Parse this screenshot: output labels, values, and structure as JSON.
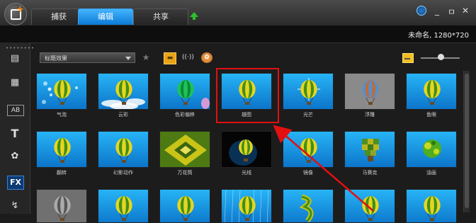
{
  "app": {
    "tabs": [
      {
        "label": "捕获",
        "active": false
      },
      {
        "label": "编辑",
        "active": true
      },
      {
        "label": "共享",
        "active": false
      }
    ],
    "window_controls": {
      "minimize": "_",
      "restore": "ㅁ",
      "close": "✕"
    },
    "project_info": "未命名, 1280*720"
  },
  "toolbar": {
    "category_select": "标题效果",
    "favorite_icon": "star-add-icon"
  },
  "sidebar": {
    "items": [
      {
        "name": "media-library-icon",
        "glyph": "▤"
      },
      {
        "name": "instant-project-icon",
        "glyph": "▦"
      },
      {
        "name": "transition-icon",
        "glyph": "AB"
      },
      {
        "name": "title-icon",
        "glyph": "T"
      },
      {
        "name": "graphic-icon",
        "glyph": "✿"
      },
      {
        "name": "filter-icon",
        "glyph": "FX"
      },
      {
        "name": "path-icon",
        "glyph": "↯"
      }
    ]
  },
  "effects": [
    {
      "label": "气泡",
      "style": "bubbles"
    },
    {
      "label": "云彩",
      "style": "clouds"
    },
    {
      "label": "色彩偏移",
      "style": "color-shift"
    },
    {
      "label": "雄图",
      "style": "plain"
    },
    {
      "label": "光芒",
      "style": "flare"
    },
    {
      "label": "浮雕",
      "style": "emboss"
    },
    {
      "label": "鱼眼",
      "style": "plain"
    },
    {
      "label": "翻转",
      "style": "plain"
    },
    {
      "label": "幻影动作",
      "style": "plain"
    },
    {
      "label": "万花筒",
      "style": "kaleido"
    },
    {
      "label": "光线",
      "style": "dark"
    },
    {
      "label": "镜像",
      "style": "plain"
    },
    {
      "label": "马赛克",
      "style": "mosaic"
    },
    {
      "label": "油画",
      "style": "oil"
    },
    {
      "label": "",
      "style": "gray"
    },
    {
      "label": "",
      "style": "plain"
    },
    {
      "label": "",
      "style": "plain"
    },
    {
      "label": "",
      "style": "rain"
    },
    {
      "label": "",
      "style": "warp"
    },
    {
      "label": "",
      "style": "plain"
    },
    {
      "label": "",
      "style": "plain"
    }
  ],
  "colors": {
    "accent": "#1f8ee8",
    "highlight_box": "#e21010",
    "arrow": "#e21010"
  }
}
